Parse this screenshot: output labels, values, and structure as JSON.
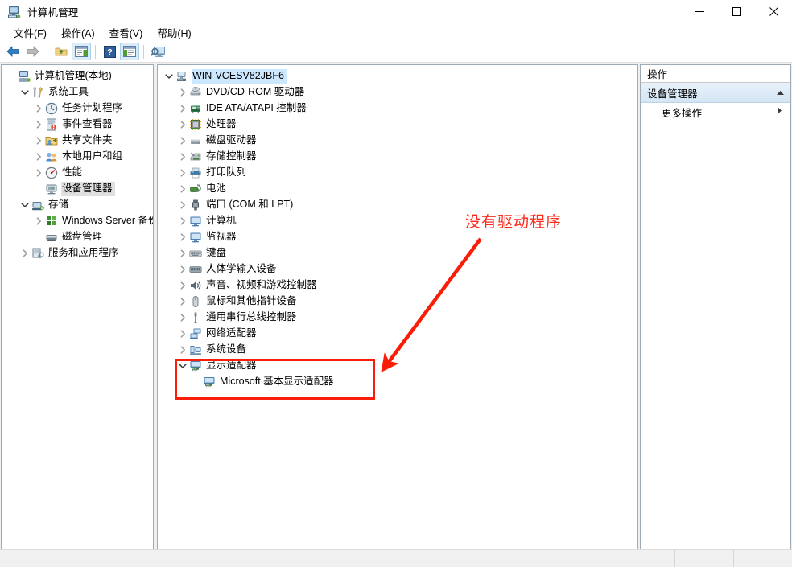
{
  "window": {
    "title": "计算机管理",
    "icon": "computer-management-icon",
    "controls": {
      "minimize": "−",
      "maximize": "□",
      "close": "✕"
    }
  },
  "menubar": {
    "items": [
      {
        "label": "文件(F)",
        "name": "menu-file"
      },
      {
        "label": "操作(A)",
        "name": "menu-action"
      },
      {
        "label": "查看(V)",
        "name": "menu-view"
      },
      {
        "label": "帮助(H)",
        "name": "menu-help"
      }
    ]
  },
  "toolbar": {
    "buttons": [
      {
        "icon": "back-arrow-icon",
        "active": false
      },
      {
        "icon": "forward-arrow-icon",
        "active": false
      },
      {
        "icon": "up-folder-icon",
        "active": false
      },
      {
        "icon": "show-console-tree-icon",
        "active": true
      },
      {
        "icon": "help-icon",
        "active": false
      },
      {
        "icon": "show-action-pane-icon",
        "active": true
      },
      {
        "icon": "scan-computer-icon",
        "active": false
      }
    ]
  },
  "sidebar": {
    "items": [
      {
        "label": "计算机管理(本地)",
        "icon": "computer-management-icon",
        "indent": 0,
        "expander": "none",
        "selected": false
      },
      {
        "label": "系统工具",
        "icon": "system-tools-icon",
        "indent": 1,
        "expander": "expanded",
        "selected": false
      },
      {
        "label": "任务计划程序",
        "icon": "task-scheduler-icon",
        "indent": 2,
        "expander": "collapsed",
        "selected": false
      },
      {
        "label": "事件查看器",
        "icon": "event-viewer-icon",
        "indent": 2,
        "expander": "collapsed",
        "selected": false
      },
      {
        "label": "共享文件夹",
        "icon": "shared-folders-icon",
        "indent": 2,
        "expander": "collapsed",
        "selected": false
      },
      {
        "label": "本地用户和组",
        "icon": "local-users-groups-icon",
        "indent": 2,
        "expander": "collapsed",
        "selected": false
      },
      {
        "label": "性能",
        "icon": "performance-icon",
        "indent": 2,
        "expander": "collapsed",
        "selected": false
      },
      {
        "label": "设备管理器",
        "icon": "device-manager-icon",
        "indent": 2,
        "expander": "none",
        "selected": true
      },
      {
        "label": "存储",
        "icon": "storage-icon",
        "indent": 1,
        "expander": "expanded",
        "selected": false
      },
      {
        "label": "Windows Server 备份",
        "icon": "windows-server-backup-icon",
        "indent": 2,
        "expander": "collapsed",
        "selected": false
      },
      {
        "label": "磁盘管理",
        "icon": "disk-management-icon",
        "indent": 2,
        "expander": "none",
        "selected": false
      },
      {
        "label": "服务和应用程序",
        "icon": "services-applications-icon",
        "indent": 1,
        "expander": "collapsed",
        "selected": false
      }
    ]
  },
  "device_tree": {
    "items": [
      {
        "label": "WIN-VCESV82JBF6",
        "icon": "computer-root-icon",
        "indent": 0,
        "expander": "expanded",
        "selected": true
      },
      {
        "label": "DVD/CD-ROM 驱动器",
        "icon": "dvd-drive-icon",
        "indent": 1,
        "expander": "collapsed",
        "selected": false
      },
      {
        "label": "IDE ATA/ATAPI 控制器",
        "icon": "ide-controller-icon",
        "indent": 1,
        "expander": "collapsed",
        "selected": false
      },
      {
        "label": "处理器",
        "icon": "processor-icon",
        "indent": 1,
        "expander": "collapsed",
        "selected": false
      },
      {
        "label": "磁盘驱动器",
        "icon": "disk-drive-icon",
        "indent": 1,
        "expander": "collapsed",
        "selected": false
      },
      {
        "label": "存储控制器",
        "icon": "storage-controller-icon",
        "indent": 1,
        "expander": "collapsed",
        "selected": false
      },
      {
        "label": "打印队列",
        "icon": "print-queue-icon",
        "indent": 1,
        "expander": "collapsed",
        "selected": false
      },
      {
        "label": "电池",
        "icon": "battery-icon",
        "indent": 1,
        "expander": "collapsed",
        "selected": false
      },
      {
        "label": "端口 (COM 和 LPT)",
        "icon": "ports-icon",
        "indent": 1,
        "expander": "collapsed",
        "selected": false
      },
      {
        "label": "计算机",
        "icon": "computer-icon",
        "indent": 1,
        "expander": "collapsed",
        "selected": false
      },
      {
        "label": "监视器",
        "icon": "monitor-icon",
        "indent": 1,
        "expander": "collapsed",
        "selected": false
      },
      {
        "label": "键盘",
        "icon": "keyboard-icon",
        "indent": 1,
        "expander": "collapsed",
        "selected": false
      },
      {
        "label": "人体学输入设备",
        "icon": "hid-icon",
        "indent": 1,
        "expander": "collapsed",
        "selected": false
      },
      {
        "label": "声音、视频和游戏控制器",
        "icon": "sound-video-game-icon",
        "indent": 1,
        "expander": "collapsed",
        "selected": false
      },
      {
        "label": "鼠标和其他指针设备",
        "icon": "mouse-icon",
        "indent": 1,
        "expander": "collapsed",
        "selected": false
      },
      {
        "label": "通用串行总线控制器",
        "icon": "usb-controller-icon",
        "indent": 1,
        "expander": "collapsed",
        "selected": false
      },
      {
        "label": "网络适配器",
        "icon": "network-adapter-icon",
        "indent": 1,
        "expander": "collapsed",
        "selected": false
      },
      {
        "label": "系统设备",
        "icon": "system-devices-icon",
        "indent": 1,
        "expander": "collapsed",
        "selected": false
      },
      {
        "label": "显示适配器",
        "icon": "display-adapter-icon",
        "indent": 1,
        "expander": "expanded",
        "selected": false
      },
      {
        "label": "Microsoft 基本显示适配器",
        "icon": "display-adapter-icon",
        "indent": 2,
        "expander": "none",
        "selected": false
      }
    ]
  },
  "actions_pane": {
    "title": "操作",
    "group_label": "设备管理器",
    "group_collapse_icon": "chevron-up-icon",
    "items": [
      {
        "label": "更多操作",
        "arrow_icon": "chevron-right-icon"
      }
    ]
  },
  "annotation": {
    "text": "没有驱动程序",
    "text_color": "#fd2b1a",
    "box_color": "#fa1e08",
    "arrow_icon": "arrow-pointer-icon"
  },
  "statusbar": {
    "text": ""
  }
}
